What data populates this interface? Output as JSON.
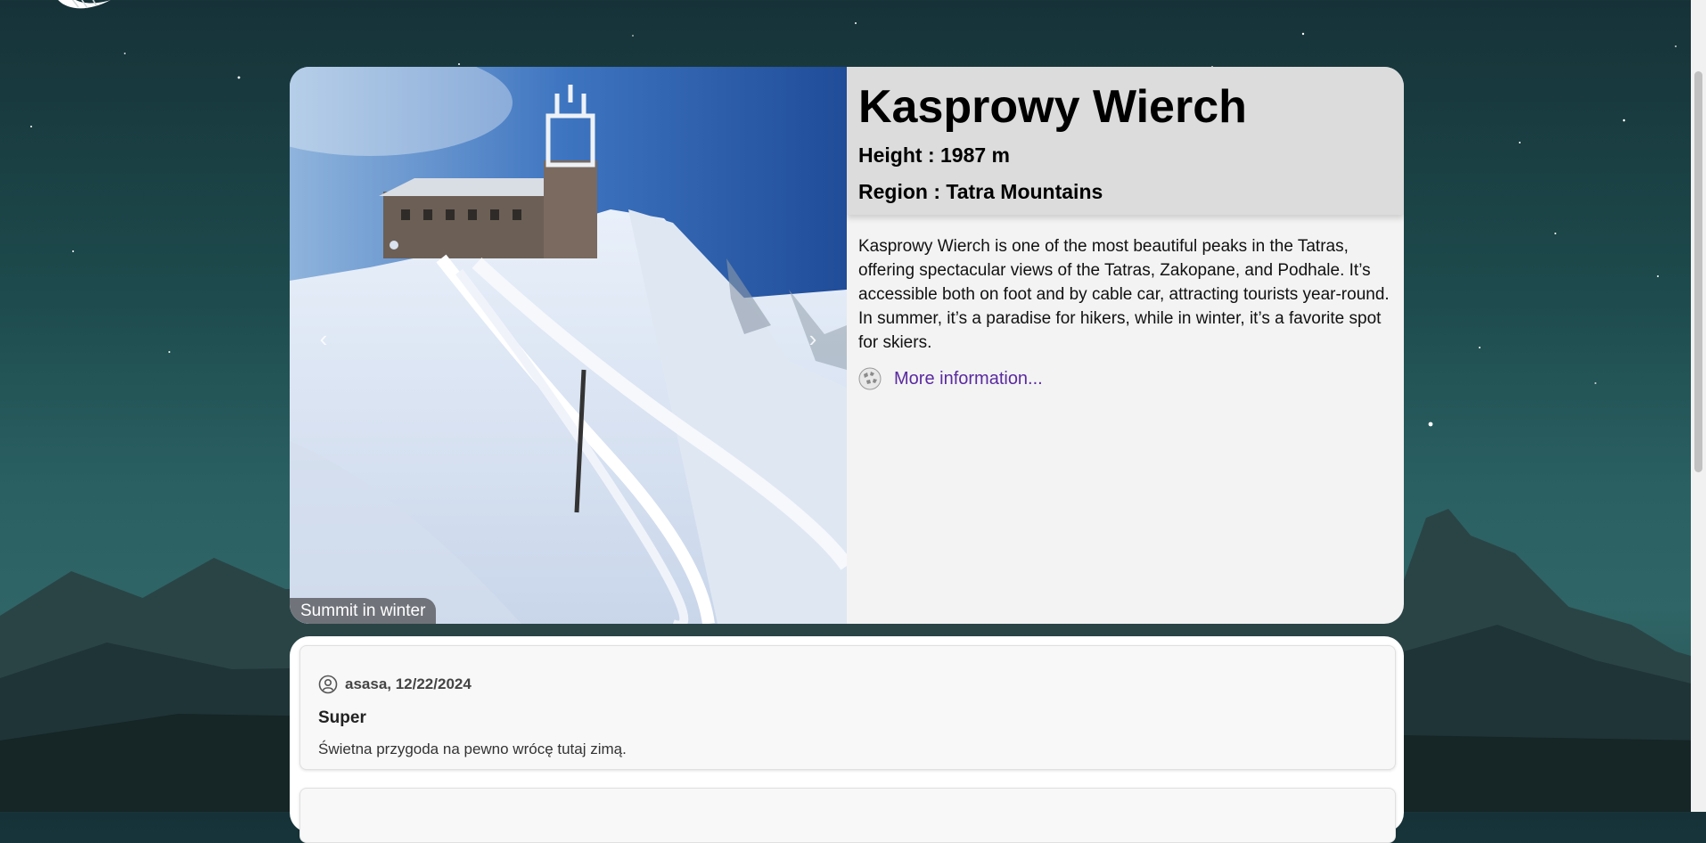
{
  "peak": {
    "title": "Kasprowy Wierch",
    "height_label": "Height : 1987 m",
    "region_label": "Region : Tatra Mountains",
    "description": "Kasprowy Wierch is one of the most beautiful peaks in the Tatras, offering spectacular views of the Tatras, Zakopane, and Podhale. It’s accessible both on foot and by cable car, attracting tourists year-round. In summer, it’s a paradise for hikers, while in winter, it’s a favorite spot for skiers.",
    "more_info_label": "More information..."
  },
  "carousel": {
    "caption": "Summit in winter",
    "prev_icon": "chevron-left-icon",
    "next_icon": "chevron-right-icon",
    "prev_glyph": "‹",
    "next_glyph": "›"
  },
  "comments": [
    {
      "author_date": "asasa, 12/22/2024",
      "title": "Super",
      "body": "Świetna przygoda na pewno wrócę tutaj zimą."
    }
  ],
  "icons": {
    "logo": "logo-icon",
    "wiki": "wikipedia-globe-icon",
    "user": "user-circle-icon"
  },
  "colors": {
    "link": "#5a2aa0",
    "header_bg": "#dcdcdc",
    "card_bg": "#f3f3f3"
  }
}
